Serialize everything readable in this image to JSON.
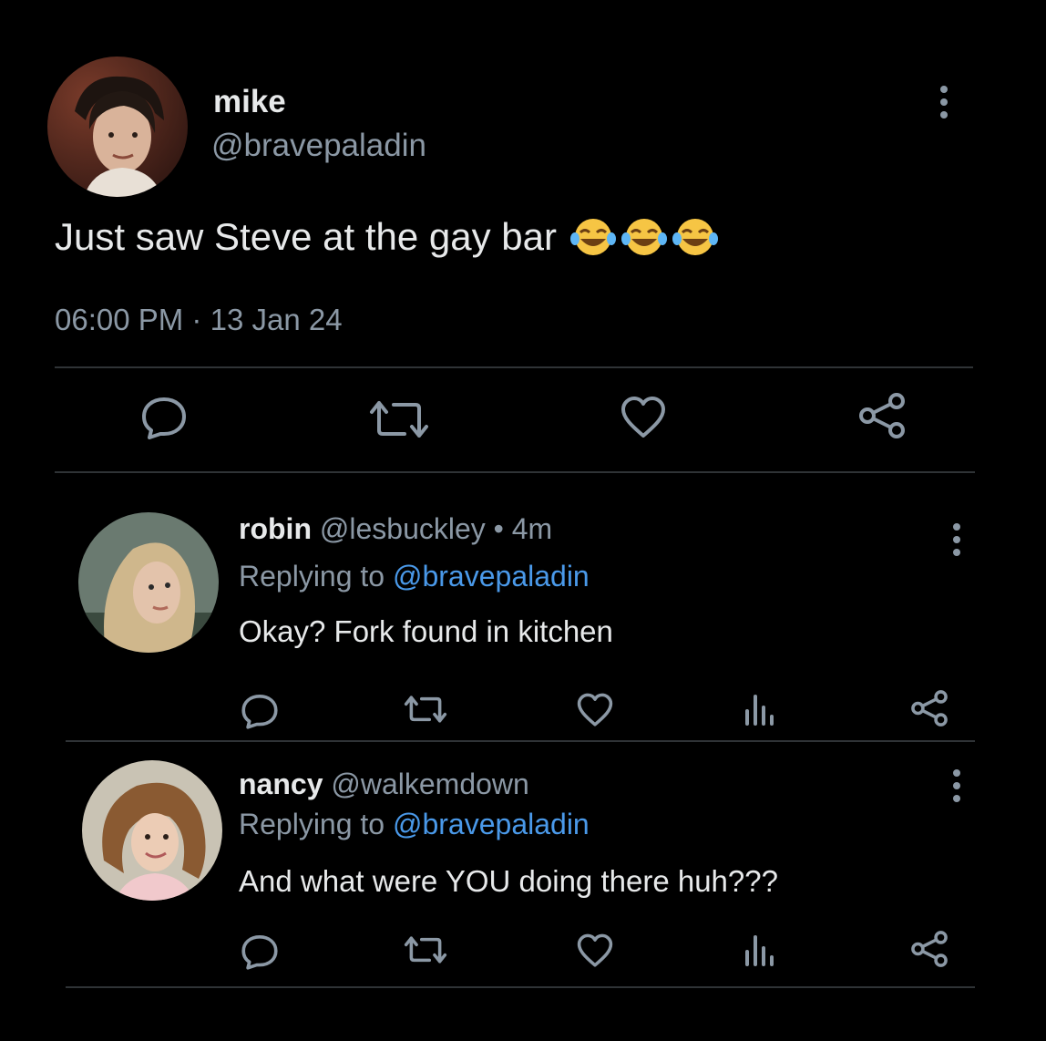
{
  "main_tweet": {
    "name": "mike",
    "handle": "@bravepaladin",
    "text": "Just saw Steve at the gay bar",
    "emoji": "😂😂😂",
    "time": "06:00 PM",
    "separator": "·",
    "date": "13 Jan 24",
    "icons": [
      "more-icon",
      "reply-icon",
      "retweet-icon",
      "like-icon",
      "share-icon"
    ]
  },
  "replies": [
    {
      "name": "robin",
      "handle": "@lesbuckley",
      "separator": "•",
      "age": "4m",
      "replying_prefix": "Replying to",
      "replying_to": "@bravepaladin",
      "text": "Okay? Fork found in kitchen"
    },
    {
      "name": "nancy",
      "handle": "@walkemdown",
      "replying_prefix": "Replying to",
      "replying_to": "@bravepaladin",
      "text": "And what were YOU doing there huh???"
    }
  ],
  "colors": {
    "background": "#000000",
    "text": "#e7e9ea",
    "muted": "#8b98a5",
    "link": "#4a99e9",
    "divider": "#2f3336"
  }
}
